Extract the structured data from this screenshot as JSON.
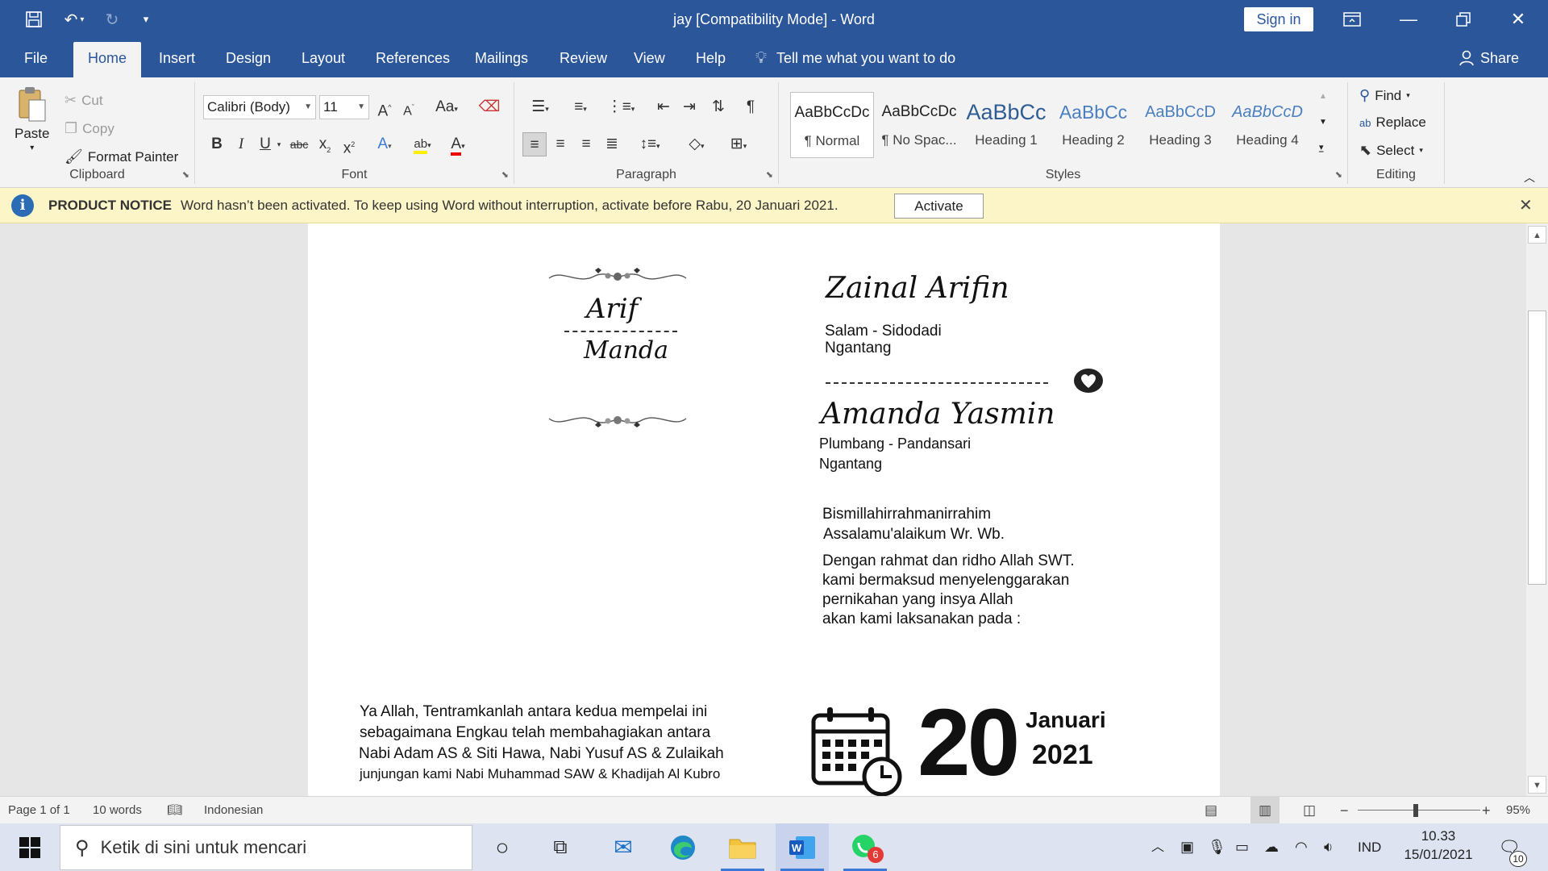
{
  "window": {
    "title": "jay [Compatibility Mode]  -  Word",
    "sign_in": "Sign in"
  },
  "tabs": [
    "File",
    "Home",
    "Insert",
    "Design",
    "Layout",
    "References",
    "Mailings",
    "Review",
    "View",
    "Help"
  ],
  "active_tab": "Home",
  "tell_me": "Tell me what you want to do",
  "share": "Share",
  "ribbon": {
    "clipboard": {
      "paste": "Paste",
      "cut": "Cut",
      "copy": "Copy",
      "format_painter": "Format Painter",
      "label": "Clipboard"
    },
    "font": {
      "name": "Calibri (Body)",
      "size": "11",
      "label": "Font"
    },
    "paragraph": {
      "label": "Paragraph"
    },
    "styles": {
      "label": "Styles",
      "items": [
        {
          "sample": "AaBbCcDc",
          "name": "¶ Normal"
        },
        {
          "sample": "AaBbCcDc",
          "name": "¶ No Spac..."
        },
        {
          "sample": "AaBbCc",
          "name": "Heading 1"
        },
        {
          "sample": "AaBbCc",
          "name": "Heading 2"
        },
        {
          "sample": "AaBbCcD",
          "name": "Heading 3"
        },
        {
          "sample": "AaBbCcD",
          "name": "Heading 4"
        }
      ]
    },
    "editing": {
      "find": "Find",
      "replace": "Replace",
      "select": "Select",
      "label": "Editing"
    }
  },
  "notice": {
    "title": "PRODUCT NOTICE",
    "text": "Word hasn’t been activated. To keep using Word without interruption, activate before Rabu, 20 Januari 2021.",
    "button": "Activate"
  },
  "document": {
    "logo_top": "Arif",
    "logo_bottom": "Manda",
    "groom_name": "Zainal Arifin",
    "groom_addr1": "Salam - Sidodadi",
    "groom_addr2": "Ngantang",
    "bride_name": "Amanda Yasmin",
    "bride_addr1": "Plumbang - Pandansari",
    "bride_addr2": "Ngantang",
    "greeting1": "Bismillahirrahmanirrahim",
    "greeting2": "Assalamu'alaikum Wr. Wb.",
    "body": [
      "Dengan rahmat dan ridho Allah SWT.",
      "kami bermaksud menyelenggarakan",
      "pernikahan yang insya Allah",
      "akan kami laksanakan pada :"
    ],
    "prayer": [
      "Ya Allah, Tentramkanlah antara kedua mempelai ini",
      "sebagaimana Engkau telah membahagiakan antara",
      "Nabi Adam AS & Siti Hawa, Nabi Yusuf AS & Zulaikah",
      "junjungan kami Nabi Muhammad SAW & Khadijah Al Kubro"
    ],
    "day": "20",
    "month": "Januari",
    "year": "2021"
  },
  "status": {
    "page": "Page 1 of 1",
    "words": "10 words",
    "language": "Indonesian",
    "zoom": "95%",
    "zoom_level": 0.95
  },
  "taskbar": {
    "search_placeholder": "Ketik di sini untuk mencari",
    "whatsapp_badge": "6",
    "lang": "IND",
    "time": "10.33",
    "date": "15/01/2021",
    "notifications": "10"
  },
  "colors": {
    "word_blue": "#2b579a",
    "notice_bg": "#fbf5c8",
    "taskbar_bg": "#dde3f0"
  }
}
